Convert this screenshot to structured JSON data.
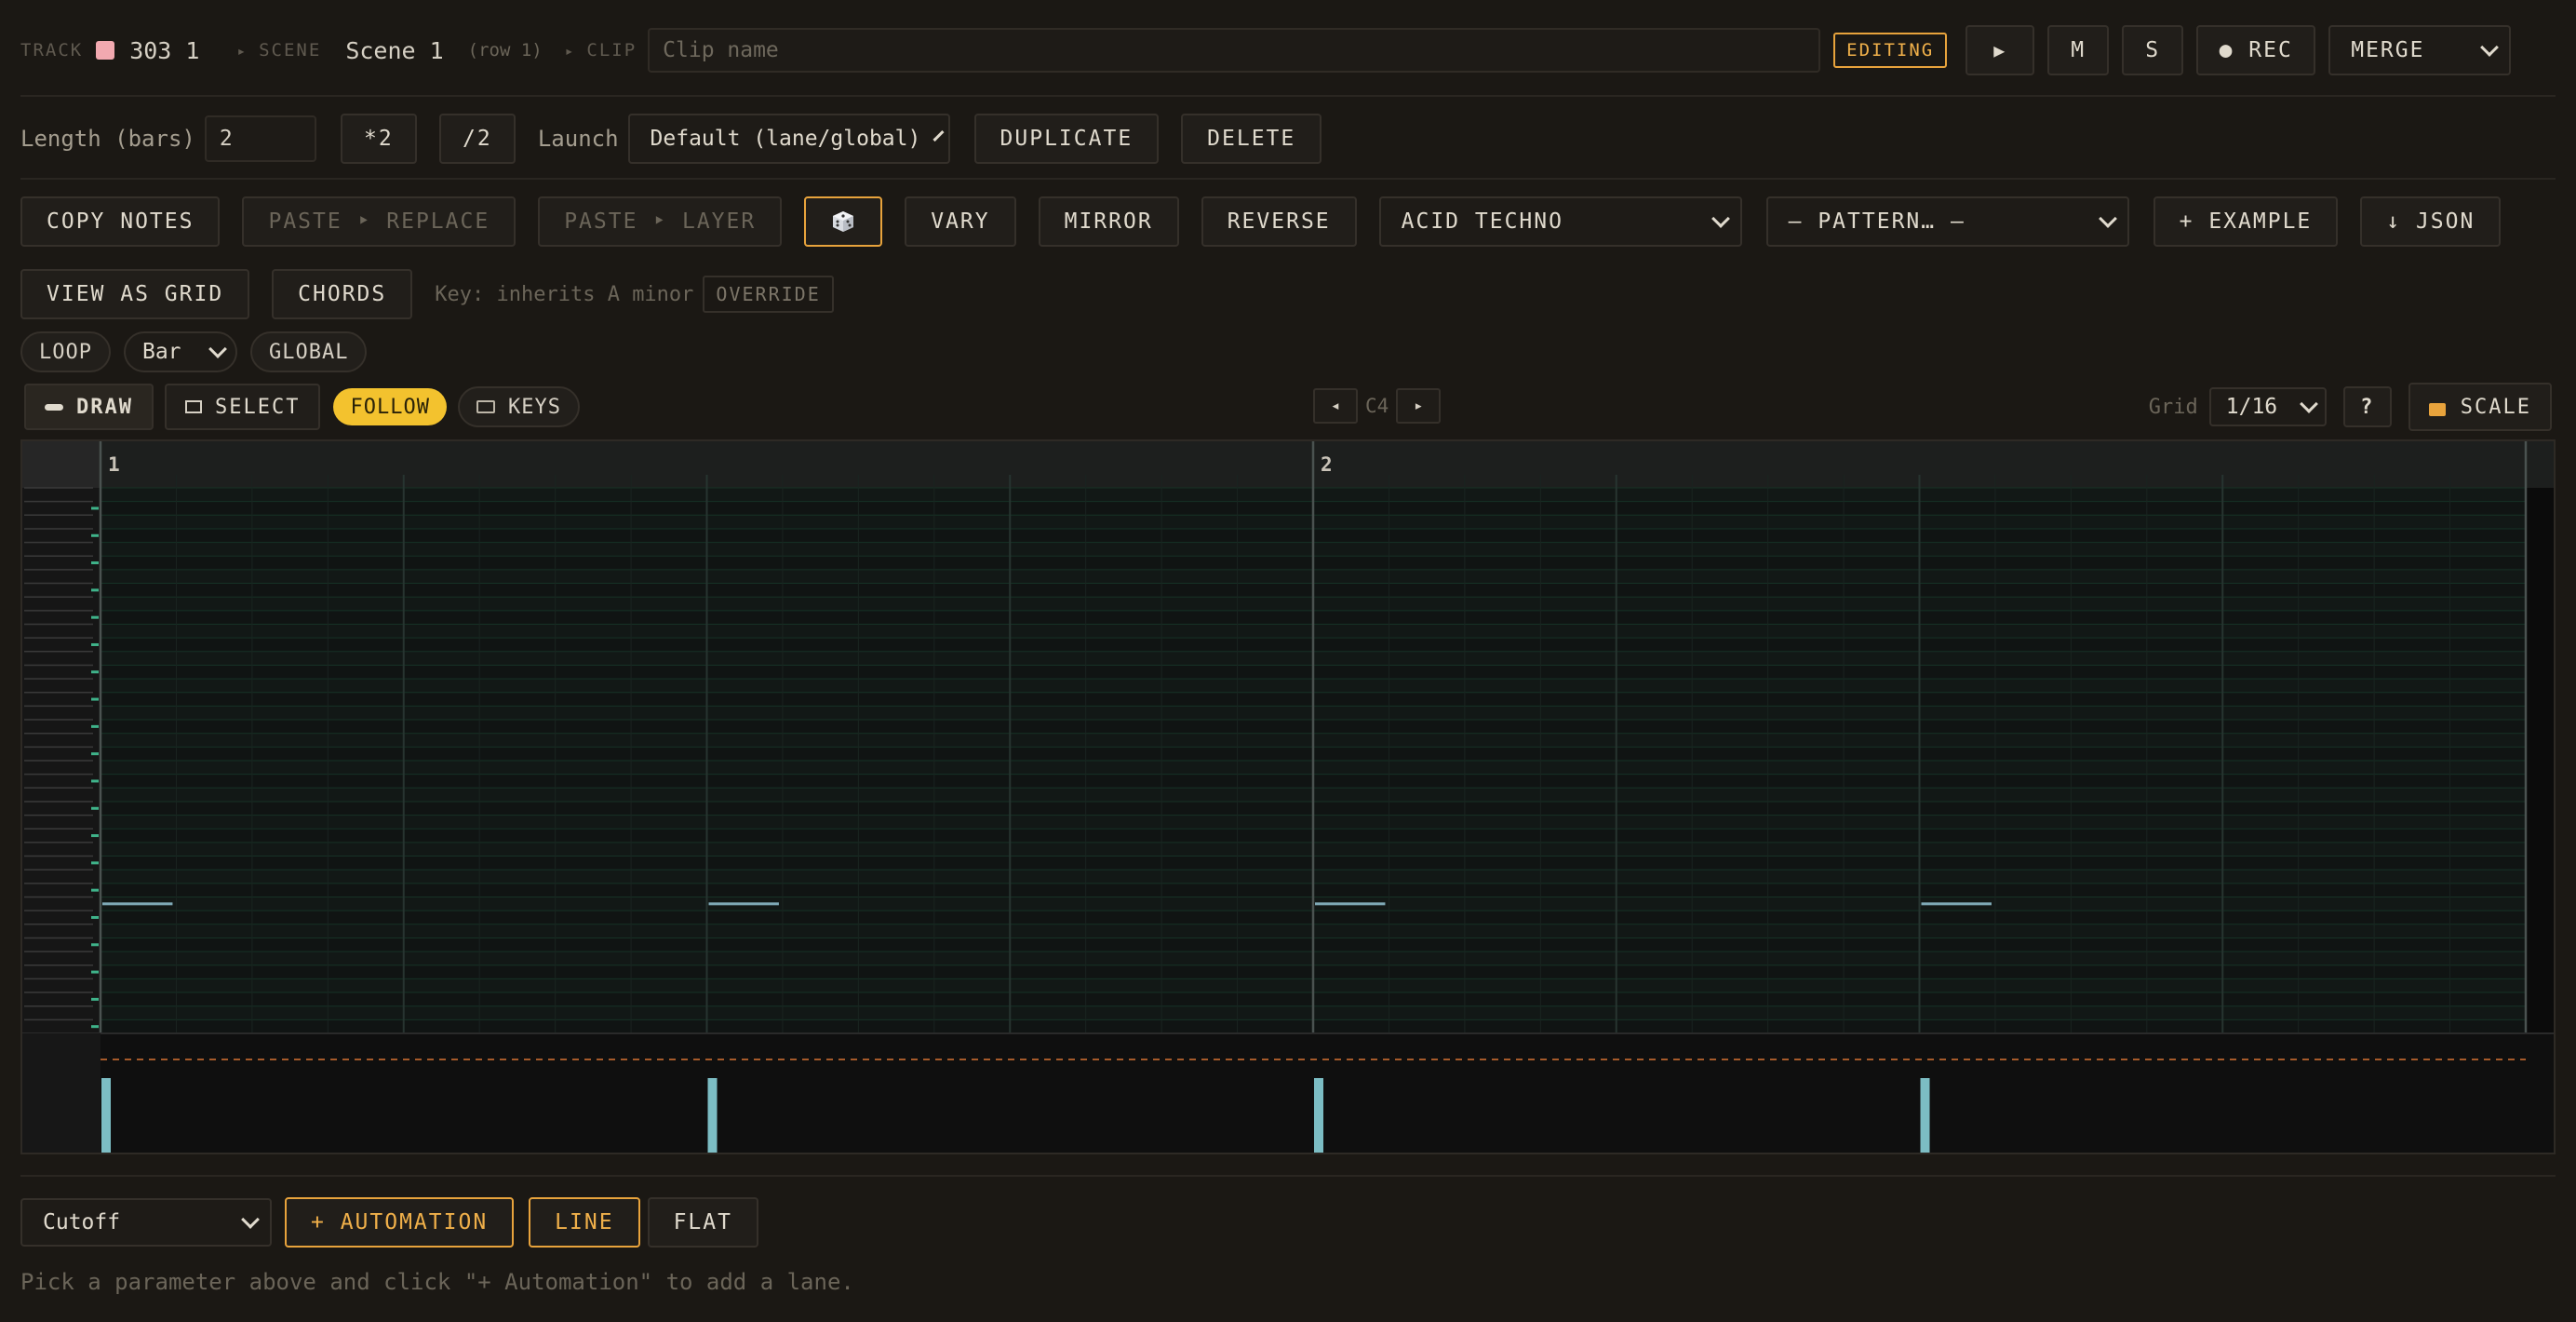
{
  "header": {
    "track_label": "TRACK",
    "track_color": "#f2a9b0",
    "track_name": "303 1",
    "scene_label": "SCENE",
    "scene_name": "Scene 1",
    "scene_row": "(row 1)",
    "clip_label": "CLIP",
    "clip_placeholder": "Clip name",
    "editing_badge": "EDITING",
    "play_icon": "▶",
    "mute_label": "M",
    "solo_label": "S",
    "rec_label": "● REC",
    "merge_value": "MERGE"
  },
  "length": {
    "label": "Length (bars)",
    "value": "2",
    "double_label": "*2",
    "half_label": "/2",
    "launch_label": "Launch",
    "launch_value": "Default (lane/global)",
    "duplicate_label": "DUPLICATE",
    "delete_label": "DELETE"
  },
  "tools": {
    "copy_notes": "COPY NOTES",
    "paste_replace": "PASTE ‣ REPLACE",
    "paste_layer": "PASTE ‣ LAYER",
    "dice_icon": "dice-icon",
    "vary": "VARY",
    "mirror": "MIRROR",
    "reverse": "REVERSE",
    "style_value": "ACID TECHNO",
    "pattern_value": "— PATTERN… —",
    "add_example": "+ EXAMPLE",
    "json_export": "↓ JSON"
  },
  "view": {
    "view_as_grid": "VIEW AS GRID",
    "chords": "CHORDS",
    "key_text": "Key: inherits A minor",
    "override": "OVERRIDE"
  },
  "loop": {
    "loop_label": "LOOP",
    "unit_value": "Bar",
    "global_label": "GLOBAL"
  },
  "editor": {
    "draw": "DRAW",
    "select": "SELECT",
    "follow": "FOLLOW",
    "keys": "KEYS",
    "octave_prev": "◂",
    "octave_label": "C4",
    "octave_next": "▸",
    "grid_label": "Grid",
    "grid_value": "1/16",
    "help": "?",
    "scale": "SCALE"
  },
  "roll": {
    "bars": [
      "1",
      "2"
    ],
    "notes": [
      {
        "bar": 1,
        "step": 1,
        "length_steps": 1
      },
      {
        "bar": 1,
        "step": 9,
        "length_steps": 1
      },
      {
        "bar": 2,
        "step": 1,
        "length_steps": 1
      },
      {
        "bar": 2,
        "step": 9,
        "length_steps": 1
      }
    ],
    "velocities": [
      {
        "bar": 1,
        "step": 1
      },
      {
        "bar": 1,
        "step": 9
      },
      {
        "bar": 2,
        "step": 1
      },
      {
        "bar": 2,
        "step": 9
      }
    ]
  },
  "automation": {
    "param_value": "Cutoff",
    "add_automation": "+ AUTOMATION",
    "line": "LINE",
    "flat": "FLAT",
    "hint": "Pick a parameter above and click \"+ Automation\" to add a lane."
  }
}
